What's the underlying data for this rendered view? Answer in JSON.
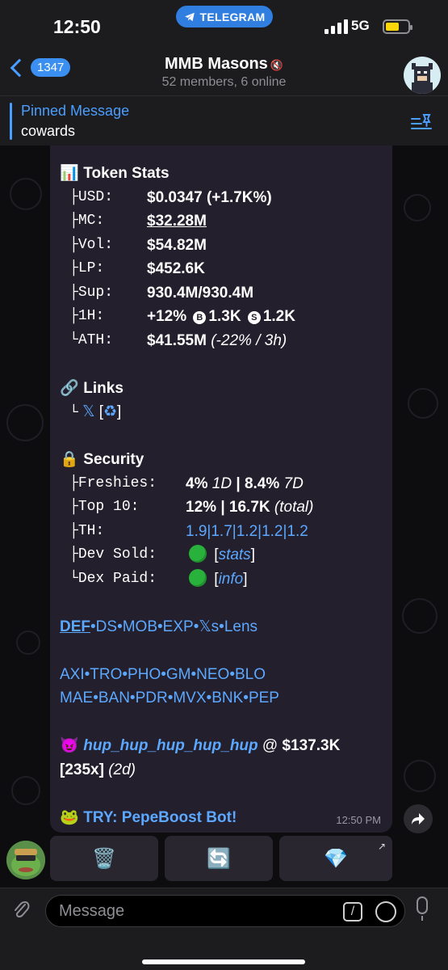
{
  "status": {
    "time": "12:50",
    "app_pill": "TELEGRAM",
    "network": "5G"
  },
  "header": {
    "back_badge": "1347",
    "title": "MMB Masons",
    "subtitle": "52 members, 6 online"
  },
  "pinned": {
    "title": "Pinned Message",
    "text": "cowards"
  },
  "message": {
    "token_stats_title": "Token Stats",
    "stats": [
      {
        "key": "USD:",
        "value": "$0.0347 (+1.7K%)"
      },
      {
        "key": "MC:",
        "value": "$32.28M"
      },
      {
        "key": "Vol:",
        "value": "$54.82M"
      },
      {
        "key": "LP:",
        "value": "$452.6K"
      },
      {
        "key": "Sup:",
        "value": "930.4M/930.4M"
      }
    ],
    "h1": {
      "key": "1H:",
      "pct": "+12%",
      "buy_icon": "B",
      "buys": "1.3K",
      "sell_icon": "S",
      "sells": "1.2K"
    },
    "ath": {
      "key": "ATH:",
      "value": "$41.55M",
      "extra": "(-22% / 3h)"
    },
    "links_title": "Links",
    "links_x": "𝕏",
    "links_rest": "[",
    "links_icon": "♻",
    "links_close": "]",
    "security_title": "Security",
    "freshies": {
      "key": "Freshies:",
      "v1": "4%",
      "p1": "1D",
      "sep": "|",
      "v2": "8.4%",
      "p2": "7D"
    },
    "top10": {
      "key": "Top 10:",
      "v1": "12%",
      "sep": "|",
      "v2": "16.7K",
      "p": "(total)"
    },
    "th": {
      "key": "TH:",
      "values": [
        "1.9",
        "1.7",
        "1.2",
        "1.2",
        "1.2"
      ]
    },
    "dev_sold": {
      "key": "Dev Sold:",
      "link": "stats"
    },
    "dex_paid": {
      "key": "Dex Paid:",
      "link": "info"
    },
    "tools_row": [
      "DEF",
      "DS",
      "MOB",
      "EXP",
      "𝕏s",
      "Lens"
    ],
    "bots_row1": [
      "AXI",
      "TRO",
      "PHO",
      "GM",
      "NEO",
      "BLO"
    ],
    "bots_row2": [
      "MAE",
      "BAN",
      "PDR",
      "MVX",
      "BNK",
      "PEP"
    ],
    "caller": {
      "name": "hup_hup_hup_hup_hup",
      "at": "@",
      "mc": "$137.3K",
      "mult": "[235x]",
      "age": "(2d)"
    },
    "promo": "TRY: PepeBoost Bot!",
    "time": "12:50 PM"
  },
  "keyboard": {
    "buttons": [
      "🗑️",
      "🔄",
      "💎"
    ]
  },
  "composer": {
    "placeholder": "Message"
  },
  "icons": {
    "stats_emoji": "📊",
    "links_emoji": "🔗",
    "security_emoji": "🔒",
    "caller_emoji": "😈",
    "promo_emoji": "🐸"
  }
}
